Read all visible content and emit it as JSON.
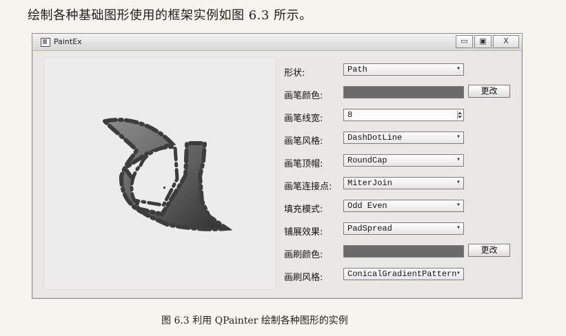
{
  "intro_text": "绘制各种基础图形使用的框架实例如图 6.3 所示。",
  "window": {
    "title": "PaintEx",
    "buttons": [
      "▭",
      "▣",
      "X"
    ]
  },
  "panel": {
    "rows": [
      {
        "label": "形状:",
        "value": "Path",
        "control": "dropdown"
      },
      {
        "label": "画笔颜色:",
        "value": "",
        "control": "color",
        "button": "更改"
      },
      {
        "label": "画笔线宽:",
        "value": "8",
        "control": "spin"
      },
      {
        "label": "画笔风格:",
        "value": "DashDotLine",
        "control": "dropdown"
      },
      {
        "label": "画笔顶帽:",
        "value": "RoundCap",
        "control": "dropdown"
      },
      {
        "label": "画笔连接点:",
        "value": "MiterJoin",
        "control": "dropdown"
      },
      {
        "label": "填充模式:",
        "value": "Odd Even",
        "control": "dropdown"
      },
      {
        "label": "铺展效果:",
        "value": "PadSpread",
        "control": "dropdown"
      },
      {
        "label": "画刷颜色:",
        "value": "",
        "control": "color",
        "button": "更改"
      },
      {
        "label": "画刷风格:",
        "value": "ConicalGradientPattern",
        "control": "dropdown"
      }
    ]
  },
  "caption": "图 6.3  利用 QPainter 绘制各种图形的实例"
}
